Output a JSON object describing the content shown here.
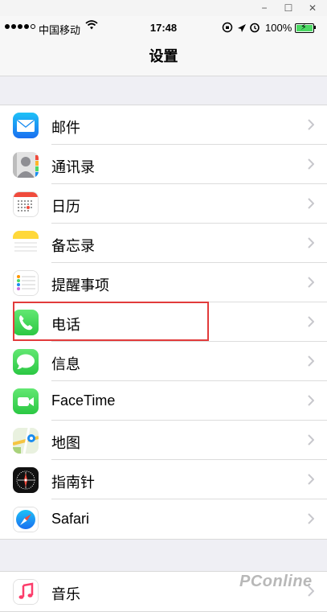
{
  "window": {
    "minimize": "−",
    "maximize": "☐",
    "close": "✕"
  },
  "status": {
    "carrier": "中国移动",
    "time": "17:48",
    "battery": "100%",
    "battery_color": "#4cd964"
  },
  "nav": {
    "title": "设置"
  },
  "groups": [
    {
      "items": [
        {
          "label": "邮件",
          "icon": "mail-icon",
          "color": "#1a8cf0"
        },
        {
          "label": "通讯录",
          "icon": "contacts-icon",
          "color": "#9e9e9e"
        },
        {
          "label": "日历",
          "icon": "calendar-icon",
          "color": "#ffffff"
        },
        {
          "label": "备忘录",
          "icon": "notes-icon",
          "color": "#ffd83a"
        },
        {
          "label": "提醒事项",
          "icon": "reminders-icon",
          "color": "#ffffff"
        },
        {
          "label": "电话",
          "icon": "phone-icon",
          "color": "#4cd964"
        },
        {
          "label": "信息",
          "icon": "messages-icon",
          "color": "#4cd964"
        },
        {
          "label": "FaceTime",
          "icon": "facetime-icon",
          "color": "#4cd964"
        },
        {
          "label": "地图",
          "icon": "maps-icon",
          "color": "#e9f1df"
        },
        {
          "label": "指南针",
          "icon": "compass-icon",
          "color": "#111111"
        },
        {
          "label": "Safari",
          "icon": "safari-icon",
          "color": "#1e90f0"
        }
      ]
    },
    {
      "items": [
        {
          "label": "音乐",
          "icon": "music-icon",
          "color": "#ffffff"
        }
      ]
    }
  ],
  "highlight_color": "#e23b3b",
  "watermark": "PConline"
}
